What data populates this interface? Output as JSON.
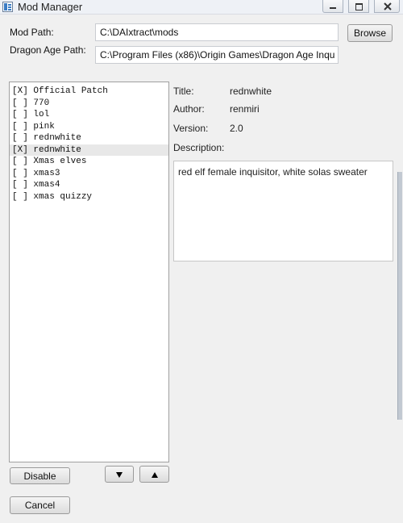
{
  "window": {
    "title": "Mod Manager"
  },
  "paths": {
    "mod_path_label": "Mod Path:",
    "mod_path_value": "C:\\DAIxtract\\mods",
    "browse_label": "Browse",
    "game_path_label": "Dragon Age Path:",
    "game_path_value": "C:\\Program Files (x86)\\Origin Games\\Dragon Age Inqu"
  },
  "mods": [
    {
      "state": "[X]",
      "name": "Official Patch"
    },
    {
      "state": "[ ]",
      "name": "770"
    },
    {
      "state": "[ ]",
      "name": "lol"
    },
    {
      "state": "[ ]",
      "name": "pink"
    },
    {
      "state": "[ ]",
      "name": "rednwhite"
    },
    {
      "state": "[X]",
      "name": "rednwhite"
    },
    {
      "state": "[ ]",
      "name": "Xmas elves"
    },
    {
      "state": "[ ]",
      "name": "xmas3"
    },
    {
      "state": "[ ]",
      "name": "xmas4"
    },
    {
      "state": "[ ]",
      "name": "xmas quizzy"
    }
  ],
  "selected_mod_index": 5,
  "details": {
    "title_label": "Title:",
    "title_value": "rednwhite",
    "author_label": "Author:",
    "author_value": "renmiri",
    "version_label": "Version:",
    "version_value": "2.0",
    "description_label": "Description:",
    "description_value": "red elf female inquisitor, white solas sweater"
  },
  "actions": {
    "disable_label": "Disable",
    "cancel_label": "Cancel",
    "move_down_icon": "triangle-down-icon",
    "move_up_icon": "triangle-up-icon"
  }
}
